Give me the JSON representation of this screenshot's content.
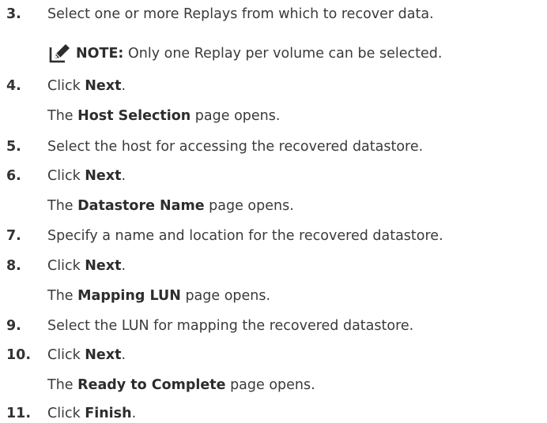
{
  "steps": [
    {
      "num": "3.",
      "pre": "Select one or more Replays from which to recover data.",
      "bold": "",
      "post": ""
    },
    {
      "num": "4.",
      "pre": "Click ",
      "bold": "Next",
      "post": "."
    },
    {
      "num": "5.",
      "pre": "Select the host for accessing the recovered datastore.",
      "bold": "",
      "post": ""
    },
    {
      "num": "6.",
      "pre": "Click ",
      "bold": "Next",
      "post": "."
    },
    {
      "num": "7.",
      "pre": "Specify a name and location for the recovered datastore.",
      "bold": "",
      "post": ""
    },
    {
      "num": "8.",
      "pre": "Click ",
      "bold": "Next",
      "post": "."
    },
    {
      "num": "9.",
      "pre": "Select the LUN for mapping the recovered datastore.",
      "bold": "",
      "post": ""
    },
    {
      "num": "10.",
      "pre": "Click ",
      "bold": "Next",
      "post": "."
    },
    {
      "num": "11.",
      "pre": "Click ",
      "bold": "Finish",
      "post": "."
    }
  ],
  "note": {
    "label": "NOTE:",
    "text": " Only one Replay per volume can be selected."
  },
  "results": [
    {
      "pre": "The ",
      "bold": "Host Selection",
      "post": " page opens."
    },
    {
      "pre": "The ",
      "bold": "Datastore Name",
      "post": " page opens."
    },
    {
      "pre": "The ",
      "bold": "Mapping LUN",
      "post": " page opens."
    },
    {
      "pre": "The ",
      "bold": "Ready to Complete",
      "post": " page opens."
    }
  ],
  "icons": {
    "note": "pencil-note-icon"
  }
}
